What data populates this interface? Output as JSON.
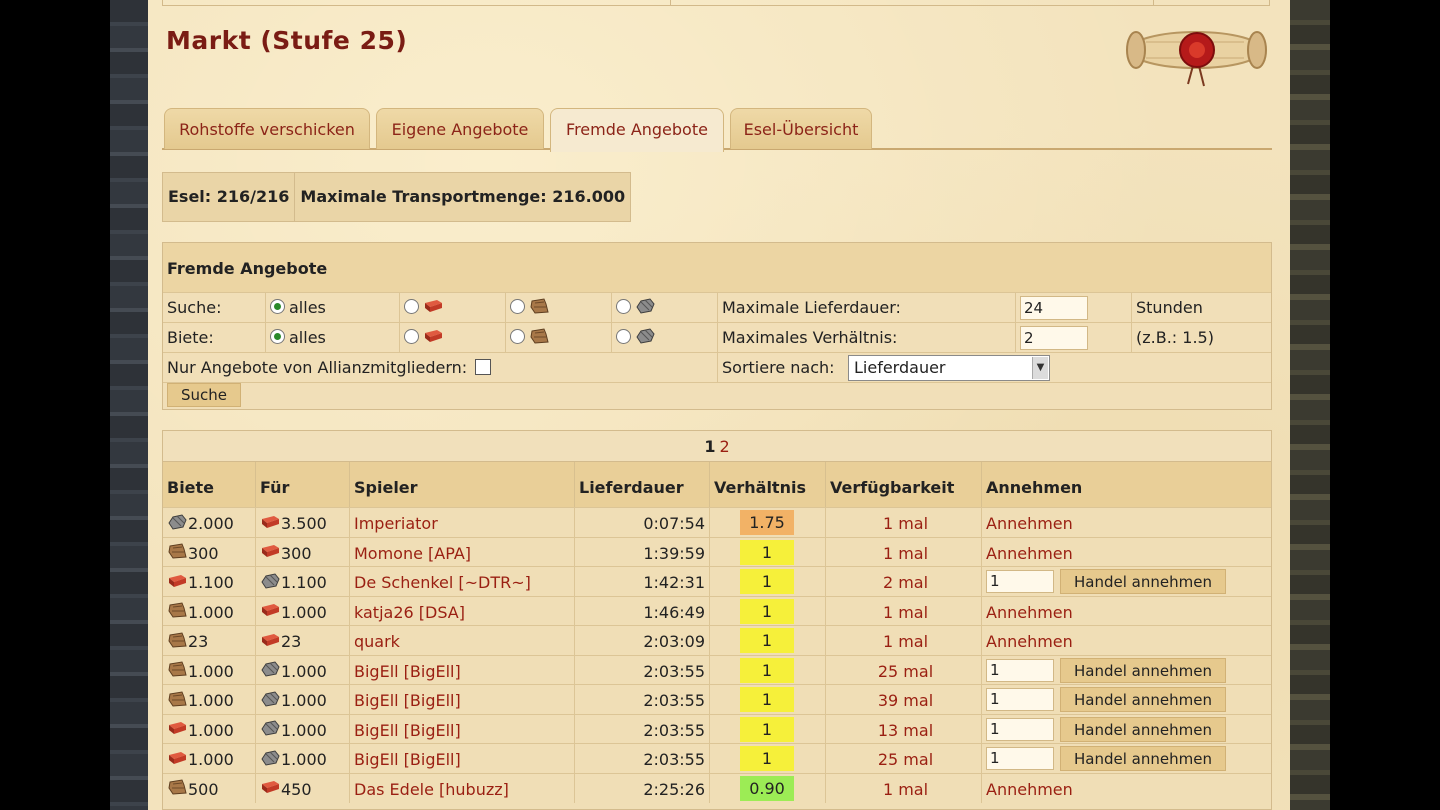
{
  "page": {
    "title": "Markt (Stufe 25)"
  },
  "tabs": [
    {
      "label": "Rohstoffe verschicken",
      "active": false
    },
    {
      "label": "Eigene Angebote",
      "active": false
    },
    {
      "label": "Fremde Angebote",
      "active": true
    },
    {
      "label": "Esel-Übersicht",
      "active": false
    }
  ],
  "stats": {
    "donkeys": "Esel: 216/216",
    "capacity": "Maximale Transportmenge: 216.000"
  },
  "search": {
    "heading": "Fremde Angebote",
    "search_label": "Suche:",
    "offer_label": "Biete:",
    "all_label": "alles",
    "max_delivery_label": "Maximale Lieferdauer:",
    "max_delivery_value": "24",
    "max_delivery_unit": "Stunden",
    "max_ratio_label": "Maximales Verhältnis:",
    "max_ratio_value": "2",
    "max_ratio_hint": "(z.B.: 1.5)",
    "alliance_only_label": "Nur Angebote von Allianzmitgliedern:",
    "sort_label": "Sortiere nach:",
    "sort_value": "Lieferdauer",
    "search_button": "Suche"
  },
  "pager": {
    "current": "1",
    "next": "2"
  },
  "table": {
    "headers": [
      "Biete",
      "Für",
      "Spieler",
      "Lieferdauer",
      "Verhältnis",
      "Verfügbarkeit",
      "Annehmen"
    ],
    "accept_link": "Annehmen",
    "accept_button": "Handel annehmen",
    "rows": [
      {
        "offer_res": "stone",
        "offer": "2.000",
        "want_res": "brick",
        "want": "3.500",
        "player": "Imperiator",
        "time": "0:07:54",
        "ratio": "1.75",
        "ratio_color": "#f2b266",
        "avail": "1 mal",
        "mode": "link"
      },
      {
        "offer_res": "wood",
        "offer": "300",
        "want_res": "brick",
        "want": "300",
        "player": "Momone [APA]",
        "time": "1:39:59",
        "ratio": "1",
        "ratio_color": "#f6f03a",
        "avail": "1 mal",
        "mode": "link"
      },
      {
        "offer_res": "brick",
        "offer": "1.100",
        "want_res": "stone",
        "want": "1.100",
        "player": "De Schenkel [~DTR~]",
        "time": "1:42:31",
        "ratio": "1",
        "ratio_color": "#f6f03a",
        "avail": "2 mal",
        "mode": "button",
        "qty": "1"
      },
      {
        "offer_res": "wood",
        "offer": "1.000",
        "want_res": "brick",
        "want": "1.000",
        "player": "katja26 [DSA]",
        "time": "1:46:49",
        "ratio": "1",
        "ratio_color": "#f6f03a",
        "avail": "1 mal",
        "mode": "link"
      },
      {
        "offer_res": "wood",
        "offer": "23",
        "want_res": "brick",
        "want": "23",
        "player": "quark",
        "time": "2:03:09",
        "ratio": "1",
        "ratio_color": "#f6f03a",
        "avail": "1 mal",
        "mode": "link"
      },
      {
        "offer_res": "wood",
        "offer": "1.000",
        "want_res": "stone",
        "want": "1.000",
        "player": "BigEll [BigEll]",
        "time": "2:03:55",
        "ratio": "1",
        "ratio_color": "#f6f03a",
        "avail": "25 mal",
        "mode": "button",
        "qty": "1"
      },
      {
        "offer_res": "wood",
        "offer": "1.000",
        "want_res": "stone",
        "want": "1.000",
        "player": "BigEll [BigEll]",
        "time": "2:03:55",
        "ratio": "1",
        "ratio_color": "#f6f03a",
        "avail": "39 mal",
        "mode": "button",
        "qty": "1"
      },
      {
        "offer_res": "brick",
        "offer": "1.000",
        "want_res": "stone",
        "want": "1.000",
        "player": "BigEll [BigEll]",
        "time": "2:03:55",
        "ratio": "1",
        "ratio_color": "#f6f03a",
        "avail": "13 mal",
        "mode": "button",
        "qty": "1"
      },
      {
        "offer_res": "brick",
        "offer": "1.000",
        "want_res": "stone",
        "want": "1.000",
        "player": "BigEll [BigEll]",
        "time": "2:03:55",
        "ratio": "1",
        "ratio_color": "#f6f03a",
        "avail": "25 mal",
        "mode": "button",
        "qty": "1"
      },
      {
        "offer_res": "wood",
        "offer": "500",
        "want_res": "brick",
        "want": "450",
        "player": "Das Edele [hubuzz]",
        "time": "2:25:26",
        "ratio": "0.90",
        "ratio_color": "#9cec55",
        "avail": "1 mal",
        "mode": "link"
      }
    ]
  },
  "colors": {
    "accent": "#9a1f12",
    "title": "#7a1c14",
    "parchment": "#f3e3bd"
  }
}
